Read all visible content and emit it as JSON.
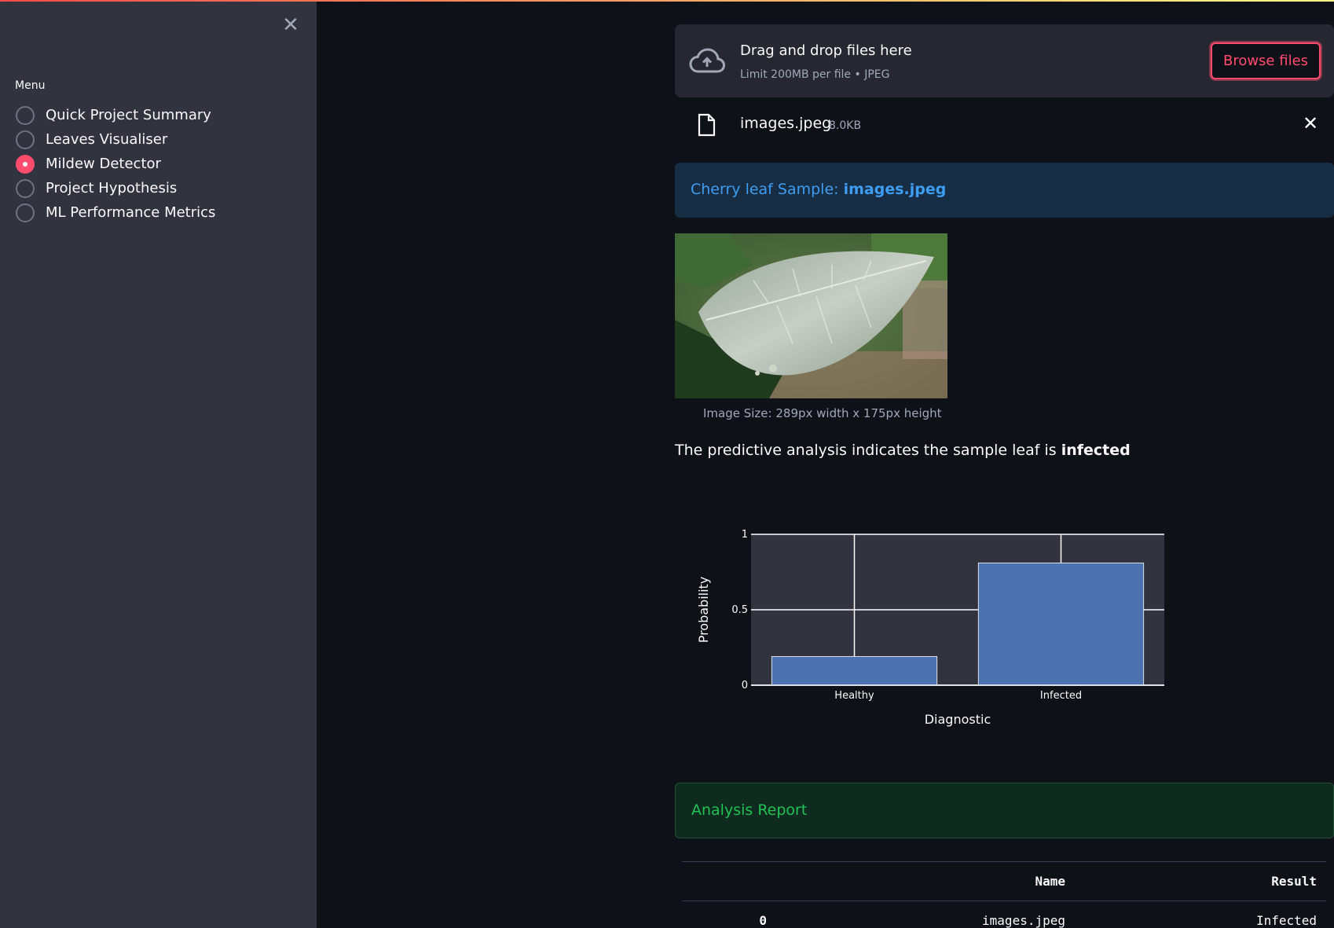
{
  "sidebar": {
    "close_icon": "close-icon",
    "menu_label": "Menu",
    "items": [
      {
        "label": "Quick Project Summary",
        "selected": false
      },
      {
        "label": "Leaves Visualiser",
        "selected": false
      },
      {
        "label": "Mildew Detector",
        "selected": true
      },
      {
        "label": "Project Hypothesis",
        "selected": false
      },
      {
        "label": "ML Performance Metrics",
        "selected": false
      }
    ]
  },
  "uploader": {
    "title": "Drag and drop files here",
    "limit": "Limit 200MB per file • JPEG",
    "browse_label": "Browse files",
    "icon": "cloud-upload-icon"
  },
  "uploaded_file": {
    "name": "images.jpeg",
    "size": "8.0KB",
    "icon": "file-icon"
  },
  "info": {
    "prefix": "Cherry leaf Sample: ",
    "filename": "images.jpeg"
  },
  "image": {
    "caption": "Image Size: 289px width x 175px height"
  },
  "prediction": {
    "text": "The predictive analysis indicates the sample leaf is ",
    "result": "infected"
  },
  "chart_data": {
    "type": "bar",
    "categories": [
      "Healthy",
      "Infected"
    ],
    "values": [
      0.19,
      0.81
    ],
    "xlabel": "Diagnostic",
    "ylabel": "Probability",
    "ylim": [
      0,
      1
    ],
    "yticks": [
      "0",
      "0.5",
      "1"
    ],
    "grid": true,
    "bar_color": "#4c72b0",
    "plot_bg": "#31333f"
  },
  "report": {
    "title": "Analysis Report",
    "columns": [
      "",
      "Name",
      "Result"
    ],
    "rows": [
      {
        "index": "0",
        "name": "images.jpeg",
        "result": "Infected"
      }
    ]
  },
  "colors": {
    "accent": "#ff4b6e",
    "info_text": "#3d9df3",
    "success_text": "#21c354"
  }
}
